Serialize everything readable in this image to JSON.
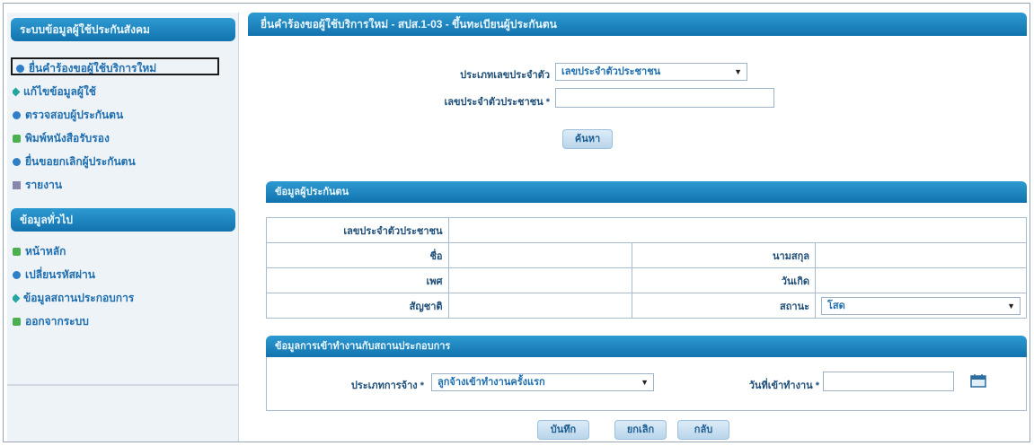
{
  "sidebar": {
    "menu_title": "ระบบข้อมูลผู้ใช้ประกันสังคม",
    "items": [
      {
        "label": "ยื่นคำร้องขอผู้ใช้บริการใหม่",
        "icon": "document-icon"
      },
      {
        "label": "แก้ไขข้อมูลผู้ใช้",
        "icon": "edit-icon"
      },
      {
        "label": "ตรวจสอบผู้ประกันตน",
        "icon": "check-icon"
      },
      {
        "label": "พิมพ์หนังสือรับรอง",
        "icon": "print-icon"
      },
      {
        "label": "ยื่นขอยกเลิกผู้ประกันตน",
        "icon": "cancel-icon"
      },
      {
        "label": "รายงาน",
        "icon": "report-icon"
      }
    ],
    "other_title": "ข้อมูลทั่วไป",
    "other_items": [
      {
        "label": "หน้าหลัก",
        "icon": "home-icon"
      },
      {
        "label": "เปลี่ยนรหัสผ่าน",
        "icon": "key-icon"
      },
      {
        "label": "ข้อมูลสถานประกอบการ",
        "icon": "building-icon"
      },
      {
        "label": "ออกจากระบบ",
        "icon": "logout-icon"
      }
    ]
  },
  "main": {
    "title": "ยื่นคำร้องขอผู้ใช้บริการใหม่ - สปส.1-03 - ขึ้นทะเบียนผู้ประกันตน",
    "search": {
      "id_type_label": "ประเภทเลขประจำตัว",
      "id_type_value": "เลขประจำตัวประชาชน",
      "id_number_label": "เลขประจำตัวประชาชน *",
      "id_number_value": "",
      "search_button": "ค้นหา"
    },
    "info_section": {
      "title": "ข้อมูลผู้ประกันตน",
      "row1": {
        "label": "เลขประจำตัวประชาชน",
        "value": ""
      },
      "row2": {
        "label_left": "ชื่อ",
        "value_left": "",
        "label_right": "นามสกุล",
        "value_right": ""
      },
      "row3": {
        "label_left": "เพศ",
        "value_left": "",
        "label_right": "วันเกิด",
        "value_right": ""
      },
      "row4": {
        "label_left": "สัญชาติ",
        "value_left": "",
        "label_right": "สถานะ",
        "value_right": "โสด"
      }
    },
    "employment_section": {
      "title": "ข้อมูลการเข้าทำงานกับสถานประกอบการ",
      "type_label": "ประเภทการจ้าง *",
      "type_value": "ลูกจ้างเข้าทำงานครั้งแรก",
      "start_date_label": "วันที่เข้าทำงาน *",
      "start_date_value": ""
    },
    "buttons": {
      "save": "บันทึก",
      "cancel": "ยกเลิก",
      "back": "กลับ"
    }
  }
}
